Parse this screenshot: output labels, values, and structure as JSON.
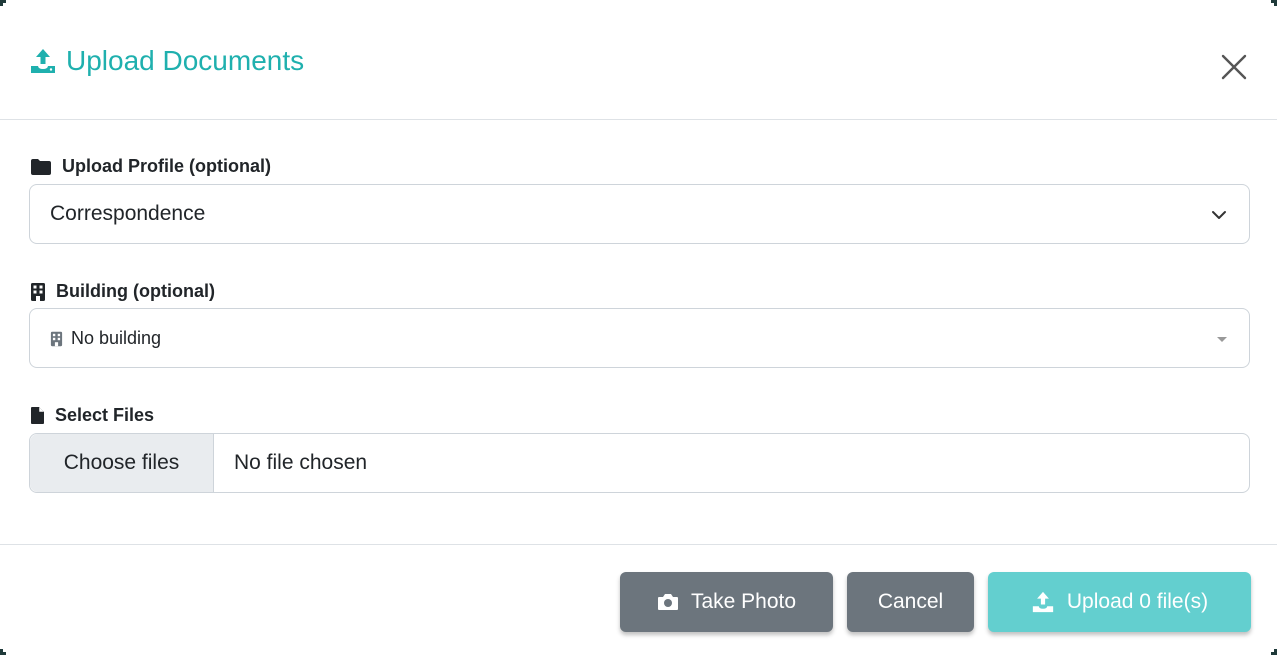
{
  "header": {
    "title": "Upload Documents",
    "title_icon": "upload-icon",
    "close_icon": "close-icon",
    "accent_color": "#1fb0ae"
  },
  "form": {
    "profile": {
      "label": "Upload Profile (optional)",
      "icon": "folder-icon",
      "selected": "Correspondence"
    },
    "building": {
      "label": "Building (optional)",
      "icon": "building-icon",
      "selected": "No building"
    },
    "files": {
      "label": "Select Files",
      "icon": "file-icon",
      "button_label": "Choose files",
      "status": "No file chosen"
    }
  },
  "footer": {
    "take_photo_label": "Take Photo",
    "cancel_label": "Cancel",
    "upload_label": "Upload 0 file(s)",
    "secondary_color": "#6c757d",
    "upload_color": "#63cfcf"
  }
}
